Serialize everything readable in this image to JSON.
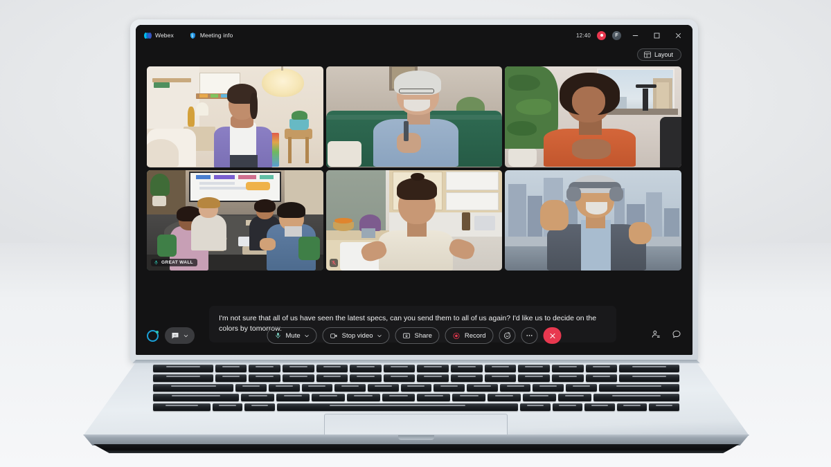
{
  "app": {
    "name": "Webex",
    "titlebar": {
      "brand_label": "Webex",
      "brand_icon": "webex-logo-icon",
      "meeting_info_label": "Meeting info",
      "meeting_info_icon": "info-shield-icon",
      "clock": "12:40",
      "recording_indicator_icon": "recording-dot-icon",
      "avatar_initial": "F",
      "minimize_icon": "minimize-icon",
      "maximize_icon": "maximize-icon",
      "close_icon": "close-icon"
    },
    "layout_button": {
      "label": "Layout",
      "icon": "grid-layout-icon"
    }
  },
  "grid": {
    "tiles": [
      {
        "id": "tile-1",
        "position": "top-left",
        "name": "",
        "active_speaker": false,
        "muted": false,
        "scene": "home-office-purple-jacket"
      },
      {
        "id": "tile-2",
        "position": "top-center",
        "name": "",
        "active_speaker": false,
        "muted": false,
        "scene": "living-room-green-sofa"
      },
      {
        "id": "tile-3",
        "position": "top-right",
        "name": "",
        "active_speaker": false,
        "muted": false,
        "scene": "office-plant-window"
      },
      {
        "id": "tile-4",
        "position": "bottom-left",
        "name": "GREAT WALL",
        "active_speaker": true,
        "muted": false,
        "scene": "conference-room"
      },
      {
        "id": "tile-5",
        "position": "bottom-center",
        "name": "",
        "active_speaker": false,
        "muted": true,
        "scene": "kitchen-cream-blouse"
      },
      {
        "id": "tile-6",
        "position": "bottom-right",
        "name": "",
        "active_speaker": false,
        "muted": false,
        "scene": "city-skyline-headphones"
      }
    ]
  },
  "captions": {
    "text": "I'm not sure that all of us have seen the latest specs, can you send them to all of us again? I'd like us to decide on the colors by tomorrow."
  },
  "controls": {
    "assistant_icon": "webex-assistant-icon",
    "captions_label": "",
    "captions_icon": "closed-captions-icon",
    "captions_chevron_icon": "chevron-down-icon",
    "mute": {
      "label": "Mute",
      "icon": "microphone-icon",
      "chevron_icon": "chevron-down-icon"
    },
    "video": {
      "label": "Stop video",
      "icon": "camera-icon",
      "chevron_icon": "chevron-down-icon"
    },
    "share": {
      "label": "Share",
      "icon": "share-screen-icon"
    },
    "record": {
      "label": "Record",
      "icon": "record-dot-icon"
    },
    "reactions": {
      "label": "",
      "icon": "smiley-reaction-icon"
    },
    "more": {
      "label": "",
      "icon": "more-ellipsis-icon"
    },
    "end_call": {
      "label": "",
      "icon": "end-call-x-icon"
    },
    "participants": {
      "label": "",
      "icon": "participants-icon"
    },
    "chat": {
      "label": "",
      "icon": "chat-bubble-icon"
    }
  },
  "colors": {
    "app_background": "#131314",
    "active_speaker": "#2ec6b0",
    "accent_blue": "#1ba0d7",
    "danger_red": "#e8384f",
    "text_primary": "#eceeef"
  }
}
